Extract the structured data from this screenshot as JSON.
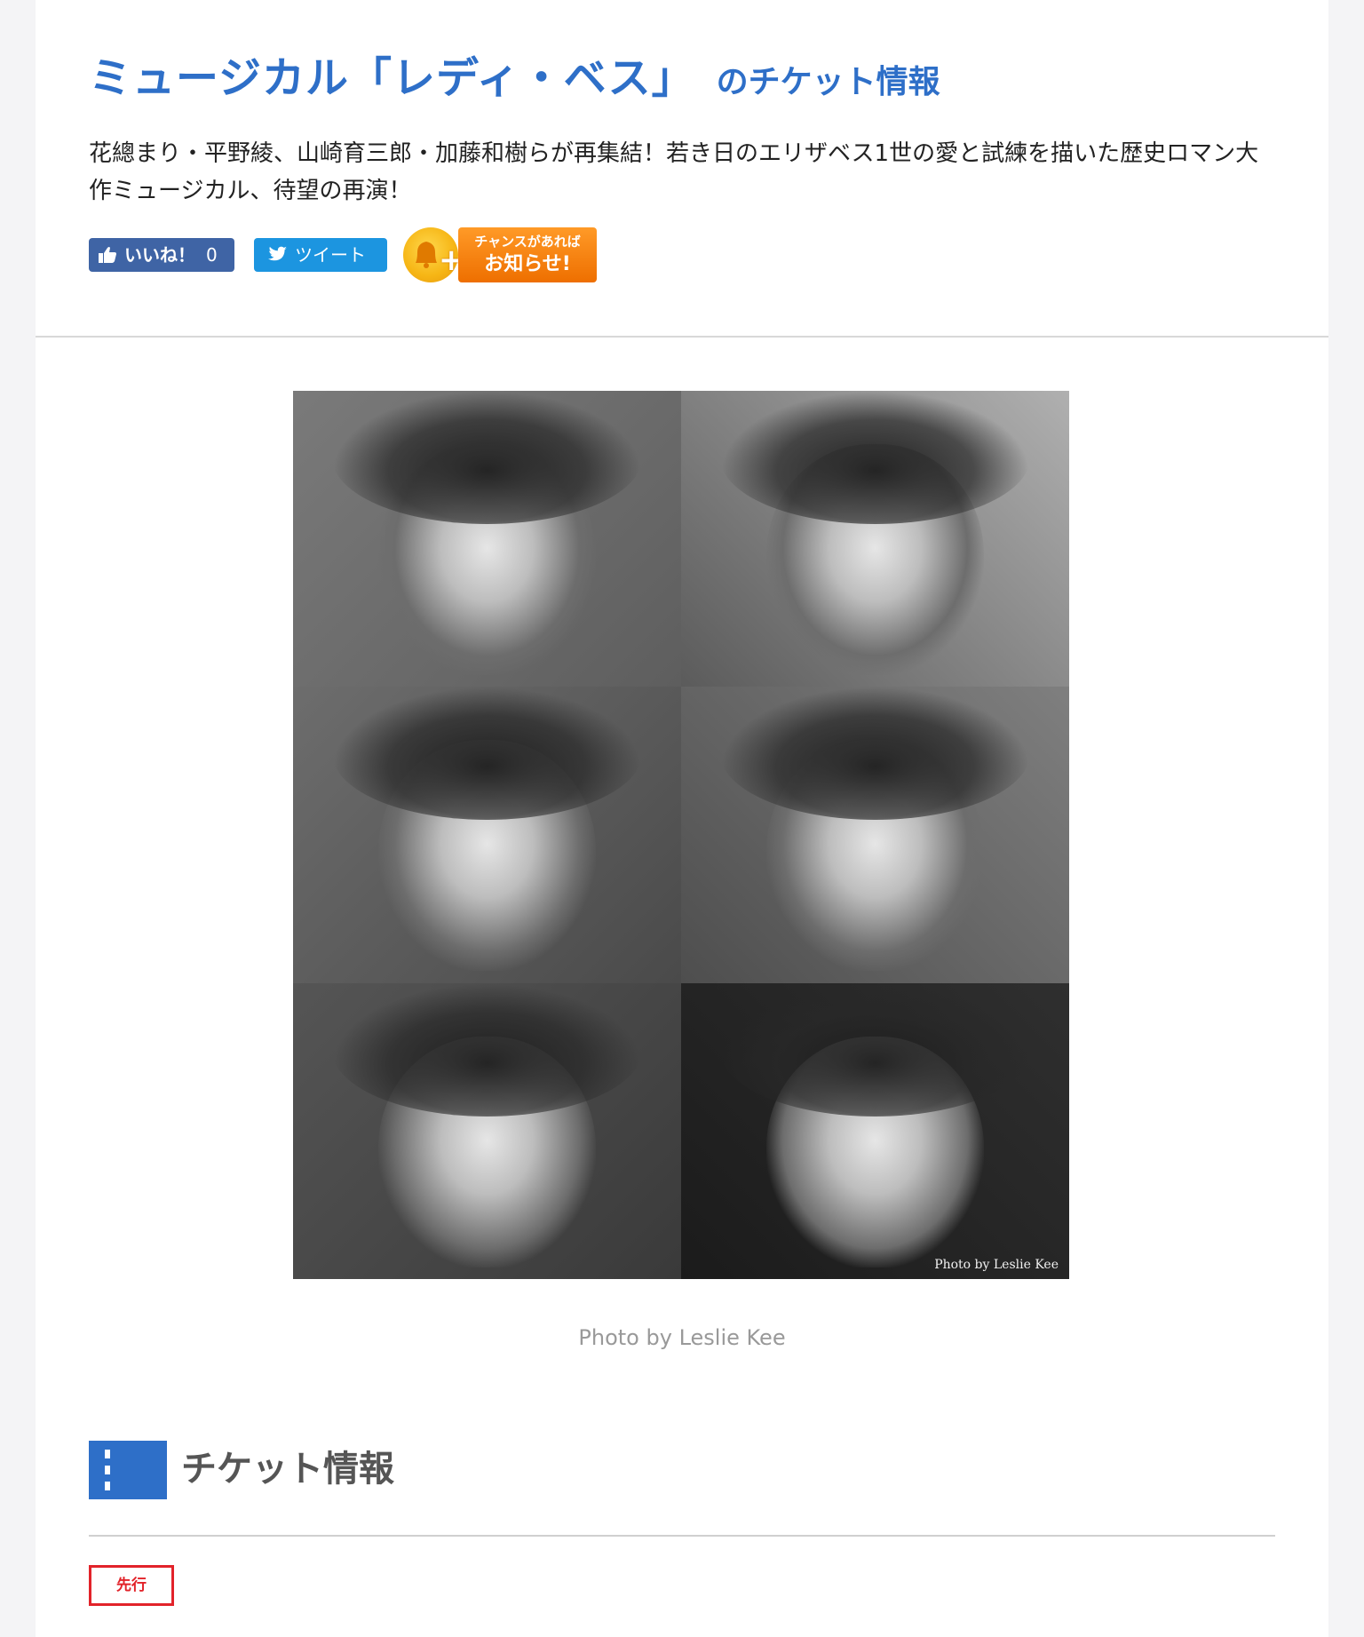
{
  "header": {
    "title_main": "ミュージカル「レディ・ベス」",
    "title_sub": "のチケット情報",
    "lead": "花總まり・平野綾、山崎育三郎・加藤和樹らが再集結！若き日のエリザベス1世の愛と試練を描いた歴史ロマン大作ミュージカル、待望の再演！"
  },
  "share": {
    "like_label": "いいね！",
    "like_count": "0",
    "tweet_label": "ツイート",
    "notify_line1": "チャンスがあれば",
    "notify_line2": "お知らせ!",
    "colors": {
      "facebook": "#3f64a5",
      "twitter": "#1c95e0",
      "notify": "#ee6f00"
    }
  },
  "photo": {
    "watermark": "Photo by Leslie Kee",
    "caption": "Photo by Leslie Kee"
  },
  "section": {
    "title": "チケット情報",
    "badge": "先行",
    "colors": {
      "accent": "#2e6fc8",
      "badge": "#e2232a"
    }
  },
  "icons": [
    "thumbs-up-icon",
    "twitter-bird-icon",
    "bell-plus-icon",
    "film-strip-icon"
  ]
}
